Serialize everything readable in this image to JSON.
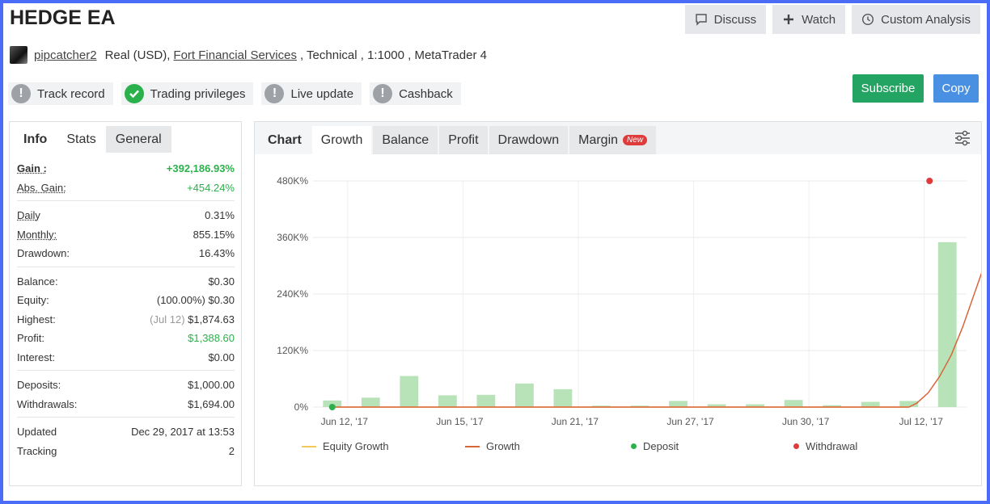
{
  "header": {
    "title": "HEDGE EA",
    "buttons": {
      "discuss": "Discuss",
      "watch": "Watch",
      "custom": "Custom Analysis"
    }
  },
  "account": {
    "username": "pipcatcher2",
    "type": "Real (USD),",
    "broker": "Fort Financial Services",
    "details": ", Technical , 1:1000 , MetaTrader 4"
  },
  "badges": [
    {
      "label": "Track record",
      "status": "grey"
    },
    {
      "label": "Trading privileges",
      "status": "green"
    },
    {
      "label": "Live update",
      "status": "grey"
    },
    {
      "label": "Cashback",
      "status": "grey"
    }
  ],
  "actions": {
    "subscribe": "Subscribe",
    "copy": "Copy"
  },
  "stats_tabs": [
    "Info",
    "Stats",
    "General"
  ],
  "stats": {
    "gain_label": "Gain :",
    "gain": "+392,186.93%",
    "abs_gain_label": "Abs. Gain:",
    "abs_gain": "+454.24%",
    "daily_label": "Daily",
    "daily": "0.31%",
    "monthly_label": "Monthly:",
    "monthly": "855.15%",
    "drawdown_label": "Drawdown:",
    "drawdown": "16.43%",
    "balance_label": "Balance:",
    "balance": "$0.30",
    "equity_label": "Equity:",
    "equity": "(100.00%) $0.30",
    "highest_label": "Highest:",
    "highest_date": "(Jul 12)",
    "highest": "$1,874.63",
    "profit_label": "Profit:",
    "profit": "$1,388.60",
    "interest_label": "Interest:",
    "interest": "$0.00",
    "deposits_label": "Deposits:",
    "deposits": "$1,000.00",
    "withdrawals_label": "Withdrawals:",
    "withdrawals": "$1,694.00",
    "updated_label": "Updated",
    "updated": "Dec 29, 2017 at 13:53",
    "tracking_label": "Tracking",
    "tracking": "2"
  },
  "chart_tabs": {
    "chart": "Chart",
    "growth": "Growth",
    "balance": "Balance",
    "profit": "Profit",
    "drawdown": "Drawdown",
    "margin": "Margin",
    "new": "New"
  },
  "legend": {
    "equity": "Equity Growth",
    "growth": "Growth",
    "deposit": "Deposit",
    "withdrawal": "Withdrawal"
  },
  "colors": {
    "bar": "#b8e2b8",
    "growth_line": "#d9653b",
    "equity_line": "#f5c85a",
    "deposit": "#2bb14c",
    "withdrawal": "#e03b3b",
    "grid": "#e8e8e8"
  },
  "chart_data": {
    "type": "bar",
    "x_ticks": [
      "Jun 12, '17",
      "Jun 15, '17",
      "Jun 21, '17",
      "Jun 27, '17",
      "Jun 30, '17",
      "Jul 12, '17"
    ],
    "y_ticks": [
      "480K%",
      "360K%",
      "240K%",
      "120K%",
      "0%"
    ],
    "ylim": [
      0,
      480000
    ],
    "bars": [
      14000,
      20000,
      66000,
      25000,
      26000,
      50000,
      38000,
      3000,
      3000,
      13000,
      6000,
      6000,
      15000,
      4000,
      11000,
      13000,
      350000
    ],
    "growth_line": [
      [
        0,
        0
      ],
      [
        0.5,
        0
      ],
      [
        1,
        0
      ],
      [
        2,
        0
      ],
      [
        3,
        0
      ],
      [
        4,
        0
      ],
      [
        5,
        0
      ],
      [
        6,
        0
      ],
      [
        7,
        0
      ],
      [
        8,
        0
      ],
      [
        9,
        0
      ],
      [
        10,
        0
      ],
      [
        11,
        0
      ],
      [
        12,
        0
      ],
      [
        13,
        0
      ],
      [
        14,
        0
      ],
      [
        15,
        0
      ],
      [
        15.2,
        8000
      ],
      [
        15.5,
        30000
      ],
      [
        15.8,
        65000
      ],
      [
        16.1,
        110000
      ],
      [
        16.4,
        170000
      ],
      [
        16.7,
        240000
      ],
      [
        17,
        310000
      ],
      [
        17.3,
        390000
      ]
    ],
    "deposits": [
      [
        0,
        0
      ]
    ],
    "withdrawals": [
      [
        16,
        480000
      ]
    ]
  }
}
